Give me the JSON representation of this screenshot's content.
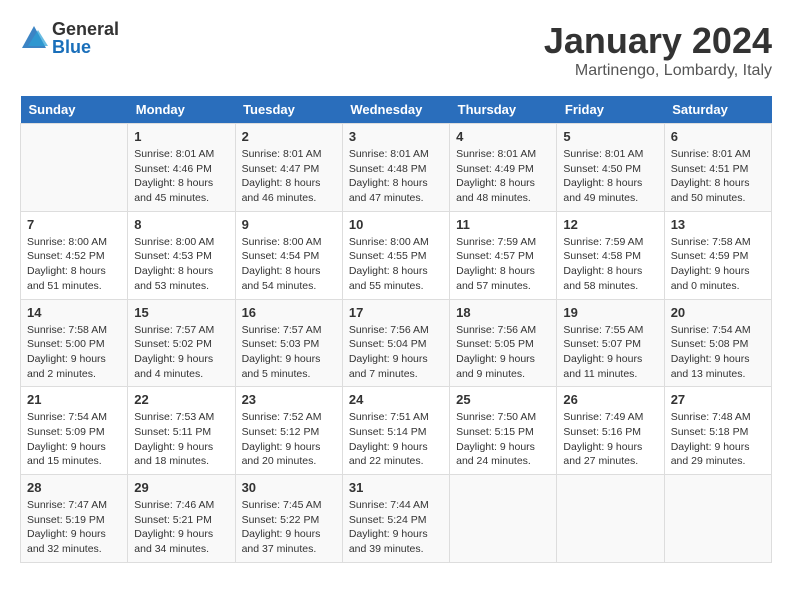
{
  "logo": {
    "general": "General",
    "blue": "Blue"
  },
  "title": "January 2024",
  "location": "Martinengo, Lombardy, Italy",
  "days_of_week": [
    "Sunday",
    "Monday",
    "Tuesday",
    "Wednesday",
    "Thursday",
    "Friday",
    "Saturday"
  ],
  "weeks": [
    [
      {
        "day": "",
        "info": ""
      },
      {
        "day": "1",
        "info": "Sunrise: 8:01 AM\nSunset: 4:46 PM\nDaylight: 8 hours\nand 45 minutes."
      },
      {
        "day": "2",
        "info": "Sunrise: 8:01 AM\nSunset: 4:47 PM\nDaylight: 8 hours\nand 46 minutes."
      },
      {
        "day": "3",
        "info": "Sunrise: 8:01 AM\nSunset: 4:48 PM\nDaylight: 8 hours\nand 47 minutes."
      },
      {
        "day": "4",
        "info": "Sunrise: 8:01 AM\nSunset: 4:49 PM\nDaylight: 8 hours\nand 48 minutes."
      },
      {
        "day": "5",
        "info": "Sunrise: 8:01 AM\nSunset: 4:50 PM\nDaylight: 8 hours\nand 49 minutes."
      },
      {
        "day": "6",
        "info": "Sunrise: 8:01 AM\nSunset: 4:51 PM\nDaylight: 8 hours\nand 50 minutes."
      }
    ],
    [
      {
        "day": "7",
        "info": "Sunrise: 8:00 AM\nSunset: 4:52 PM\nDaylight: 8 hours\nand 51 minutes."
      },
      {
        "day": "8",
        "info": "Sunrise: 8:00 AM\nSunset: 4:53 PM\nDaylight: 8 hours\nand 53 minutes."
      },
      {
        "day": "9",
        "info": "Sunrise: 8:00 AM\nSunset: 4:54 PM\nDaylight: 8 hours\nand 54 minutes."
      },
      {
        "day": "10",
        "info": "Sunrise: 8:00 AM\nSunset: 4:55 PM\nDaylight: 8 hours\nand 55 minutes."
      },
      {
        "day": "11",
        "info": "Sunrise: 7:59 AM\nSunset: 4:57 PM\nDaylight: 8 hours\nand 57 minutes."
      },
      {
        "day": "12",
        "info": "Sunrise: 7:59 AM\nSunset: 4:58 PM\nDaylight: 8 hours\nand 58 minutes."
      },
      {
        "day": "13",
        "info": "Sunrise: 7:58 AM\nSunset: 4:59 PM\nDaylight: 9 hours\nand 0 minutes."
      }
    ],
    [
      {
        "day": "14",
        "info": "Sunrise: 7:58 AM\nSunset: 5:00 PM\nDaylight: 9 hours\nand 2 minutes."
      },
      {
        "day": "15",
        "info": "Sunrise: 7:57 AM\nSunset: 5:02 PM\nDaylight: 9 hours\nand 4 minutes."
      },
      {
        "day": "16",
        "info": "Sunrise: 7:57 AM\nSunset: 5:03 PM\nDaylight: 9 hours\nand 5 minutes."
      },
      {
        "day": "17",
        "info": "Sunrise: 7:56 AM\nSunset: 5:04 PM\nDaylight: 9 hours\nand 7 minutes."
      },
      {
        "day": "18",
        "info": "Sunrise: 7:56 AM\nSunset: 5:05 PM\nDaylight: 9 hours\nand 9 minutes."
      },
      {
        "day": "19",
        "info": "Sunrise: 7:55 AM\nSunset: 5:07 PM\nDaylight: 9 hours\nand 11 minutes."
      },
      {
        "day": "20",
        "info": "Sunrise: 7:54 AM\nSunset: 5:08 PM\nDaylight: 9 hours\nand 13 minutes."
      }
    ],
    [
      {
        "day": "21",
        "info": "Sunrise: 7:54 AM\nSunset: 5:09 PM\nDaylight: 9 hours\nand 15 minutes."
      },
      {
        "day": "22",
        "info": "Sunrise: 7:53 AM\nSunset: 5:11 PM\nDaylight: 9 hours\nand 18 minutes."
      },
      {
        "day": "23",
        "info": "Sunrise: 7:52 AM\nSunset: 5:12 PM\nDaylight: 9 hours\nand 20 minutes."
      },
      {
        "day": "24",
        "info": "Sunrise: 7:51 AM\nSunset: 5:14 PM\nDaylight: 9 hours\nand 22 minutes."
      },
      {
        "day": "25",
        "info": "Sunrise: 7:50 AM\nSunset: 5:15 PM\nDaylight: 9 hours\nand 24 minutes."
      },
      {
        "day": "26",
        "info": "Sunrise: 7:49 AM\nSunset: 5:16 PM\nDaylight: 9 hours\nand 27 minutes."
      },
      {
        "day": "27",
        "info": "Sunrise: 7:48 AM\nSunset: 5:18 PM\nDaylight: 9 hours\nand 29 minutes."
      }
    ],
    [
      {
        "day": "28",
        "info": "Sunrise: 7:47 AM\nSunset: 5:19 PM\nDaylight: 9 hours\nand 32 minutes."
      },
      {
        "day": "29",
        "info": "Sunrise: 7:46 AM\nSunset: 5:21 PM\nDaylight: 9 hours\nand 34 minutes."
      },
      {
        "day": "30",
        "info": "Sunrise: 7:45 AM\nSunset: 5:22 PM\nDaylight: 9 hours\nand 37 minutes."
      },
      {
        "day": "31",
        "info": "Sunrise: 7:44 AM\nSunset: 5:24 PM\nDaylight: 9 hours\nand 39 minutes."
      },
      {
        "day": "",
        "info": ""
      },
      {
        "day": "",
        "info": ""
      },
      {
        "day": "",
        "info": ""
      }
    ]
  ]
}
